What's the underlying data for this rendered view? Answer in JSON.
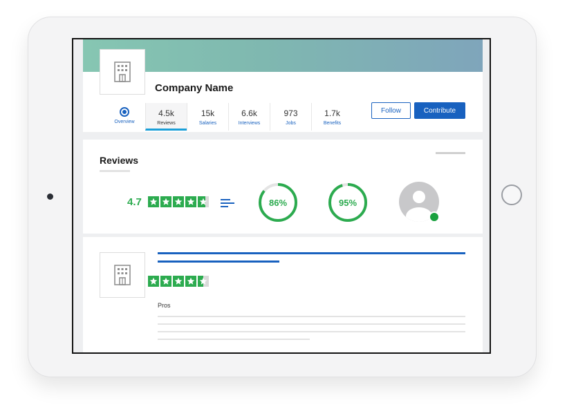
{
  "company": {
    "name": "Company Name",
    "logo_icon": "building-icon"
  },
  "tabs": [
    {
      "count": "",
      "label": "Overview",
      "icon": "target-icon",
      "active": false
    },
    {
      "count": "4.5k",
      "label": "Reviews",
      "active": true
    },
    {
      "count": "15k",
      "label": "Salaries",
      "active": false
    },
    {
      "count": "6.6k",
      "label": "Interviews",
      "active": false
    },
    {
      "count": "973",
      "label": "Jobs",
      "active": false
    },
    {
      "count": "1.7k",
      "label": "Benefits",
      "active": false
    }
  ],
  "actions": {
    "follow_label": "Follow",
    "contribute_label": "Contribute"
  },
  "reviews_summary": {
    "title": "Reviews",
    "rating": "4.7",
    "rating_stars": 4.7,
    "recommend_percent_label": "86%",
    "recommend_percent": 86,
    "ceo_approval_label": "95%",
    "ceo_approval": 95,
    "avatar_icon": "user-avatar-icon"
  },
  "review": {
    "logo_icon": "building-icon",
    "rating_stars": 4.5,
    "pros_label": "Pros"
  },
  "colors": {
    "brand_blue": "#1861bf",
    "rating_green": "#2cab4f",
    "active_tab_underline": "#1a9fd8"
  }
}
